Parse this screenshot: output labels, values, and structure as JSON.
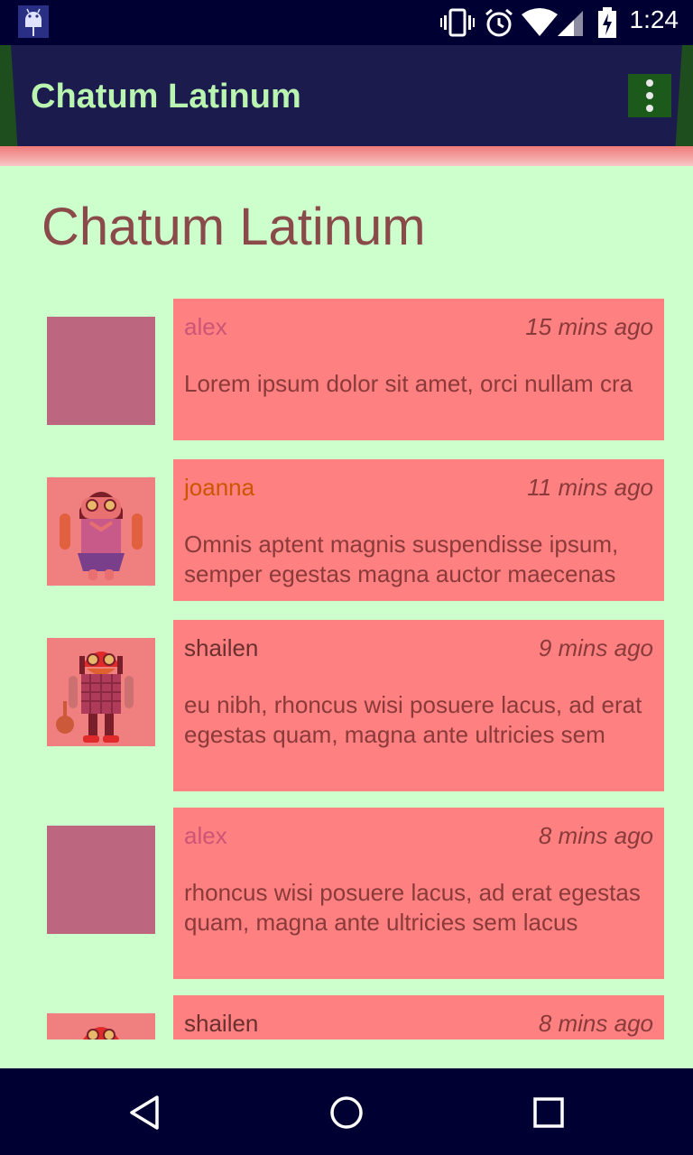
{
  "status_bar": {
    "time": "1:24",
    "icons": [
      "android-debug-icon",
      "vibrate-icon",
      "alarm-icon",
      "wifi-icon",
      "signal-icon",
      "battery-charging-icon"
    ]
  },
  "app_bar": {
    "title": "Chatum Latinum",
    "overflow_icon": "more-vert-icon"
  },
  "page": {
    "title": "Chatum Latinum"
  },
  "messages": [
    {
      "user": "alex",
      "time": "15 mins ago",
      "text": "Lorem ipsum dolor sit amet, orci nullam cra",
      "avatar": "blank-avatar",
      "name_color": "#cc5577"
    },
    {
      "user": "joanna",
      "time": "11 mins ago",
      "text": "Omnis aptent magnis suspendisse ipsum, semper egestas magna auctor maecenas",
      "avatar": "android-girl-avatar",
      "name_color": "#cc5500"
    },
    {
      "user": "shailen",
      "time": "9 mins ago",
      "text": "eu nibh, rhoncus wisi posuere lacus, ad erat egestas quam, magna ante ultricies sem",
      "avatar": "android-hipster-avatar",
      "name_color": "#6a2f2f"
    },
    {
      "user": "alex",
      "time": "8 mins ago",
      "text": "rhoncus wisi posuere lacus, ad erat egestas quam, magna ante ultricies sem lacus",
      "avatar": "blank-avatar",
      "name_color": "#cc5577"
    },
    {
      "user": "shailen",
      "time": "8 mins ago",
      "text": "",
      "avatar": "android-hipster-avatar",
      "name_color": "#6a2f2f"
    }
  ],
  "nav_bar": {
    "back": "back-icon",
    "home": "home-icon",
    "recents": "recents-icon"
  },
  "colors": {
    "app_bar": "#1b1b4d",
    "content_bg": "#ccffcc",
    "bubble": "#ff8080",
    "title_text": "#b9f4b0"
  }
}
